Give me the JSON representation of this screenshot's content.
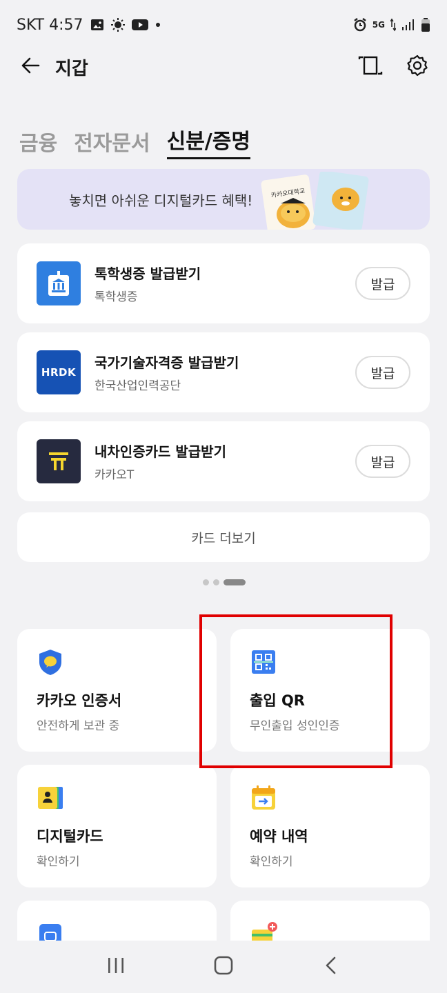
{
  "status_bar": {
    "carrier_time": "SKT 4:57",
    "network": "5G",
    "icons": [
      "gallery-icon",
      "brightness-icon",
      "youtube-icon",
      "dot-icon",
      "alarm-icon",
      "data-arrows-icon",
      "signal-icon",
      "battery-icon"
    ]
  },
  "app_bar": {
    "title": "지갑",
    "icons": [
      "back-arrow-icon",
      "card-scan-icon",
      "gear-icon"
    ]
  },
  "tabs": [
    {
      "label": "금융",
      "active": false
    },
    {
      "label": "전자문서",
      "active": false
    },
    {
      "label": "신분/증명",
      "active": true
    }
  ],
  "banner": {
    "text": "놓치면 아쉬운 디지털카드 혜택!",
    "card_text": "카카오대학교"
  },
  "issue_cards": [
    {
      "title": "톡학생증 발급받기",
      "subtitle": "톡학생증",
      "button": "발급",
      "icon": "school-building-icon",
      "color": "#2f7fe0"
    },
    {
      "title": "국가기술자격증 발급받기",
      "subtitle": "한국산업인력공단",
      "button": "발급",
      "icon": "hrdk-logo-icon",
      "logo_text": "HRDK",
      "color": "#1652b4"
    },
    {
      "title": "내차인증카드 발급받기",
      "subtitle": "카카오T",
      "button": "발급",
      "icon": "kakao-t-logo-icon",
      "color": "#262a3f",
      "accent": "#f5d62e"
    }
  ],
  "more_button": "카드 더보기",
  "pager": {
    "count": 3,
    "active_index": 2
  },
  "grid": [
    {
      "title": "카카오 인증서",
      "subtitle": "안전하게 보관 중",
      "icon": "shield-icon"
    },
    {
      "title": "출입 QR",
      "subtitle": "무인출입 성인인증",
      "icon": "qr-code-icon"
    },
    {
      "title": "디지털카드",
      "subtitle": "확인하기",
      "icon": "id-card-icon"
    },
    {
      "title": "예약 내역",
      "subtitle": "확인하기",
      "icon": "calendar-icon"
    },
    {
      "title": "",
      "subtitle": "",
      "icon": "card-blue-icon"
    },
    {
      "title": "",
      "subtitle": "",
      "icon": "wallet-plus-icon"
    }
  ],
  "nav_bar": {
    "icons": [
      "recent-apps-icon",
      "home-icon",
      "back-icon"
    ]
  },
  "colors": {
    "background": "#f2f2f4",
    "highlight": "#e00000",
    "banner": "#e4e2f6"
  }
}
